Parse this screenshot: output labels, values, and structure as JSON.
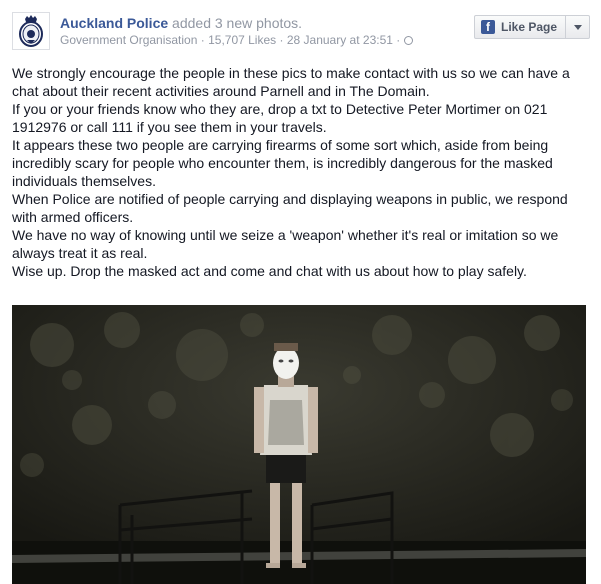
{
  "header": {
    "page_name": "Auckland Police",
    "action": "added 3 new photos.",
    "meta": {
      "category": "Government Organisation",
      "likes": "15,707 Likes",
      "timestamp": "28 January at 23:51",
      "separator": "·"
    }
  },
  "like_button": {
    "label": "Like Page",
    "icon": "facebook-f-icon"
  },
  "post": {
    "paragraphs": [
      "We strongly encourage the people in these pics to make contact with us so we can have a chat about their recent activities around Parnell and in The Domain.",
      "If you or your friends know who they are, drop a txt to Detective Peter Mortimer on 021 1912976 or call 111 if you see them in your travels.",
      "It appears these two people are carrying firearms of some sort which, aside from being incredibly scary for people who encounter them, is incredibly dangerous for the masked individuals themselves.",
      "When Police are notified of people carrying and displaying weapons in public, we respond with armed officers.",
      "We have no way of knowing until we seize a 'weapon' whether it's real or imitation so we always treat it as real.",
      "Wise up. Drop the masked act and come and chat with us about how to play safely."
    ]
  },
  "colors": {
    "link": "#3b5998",
    "meta": "#9197a3",
    "text": "#141823"
  }
}
